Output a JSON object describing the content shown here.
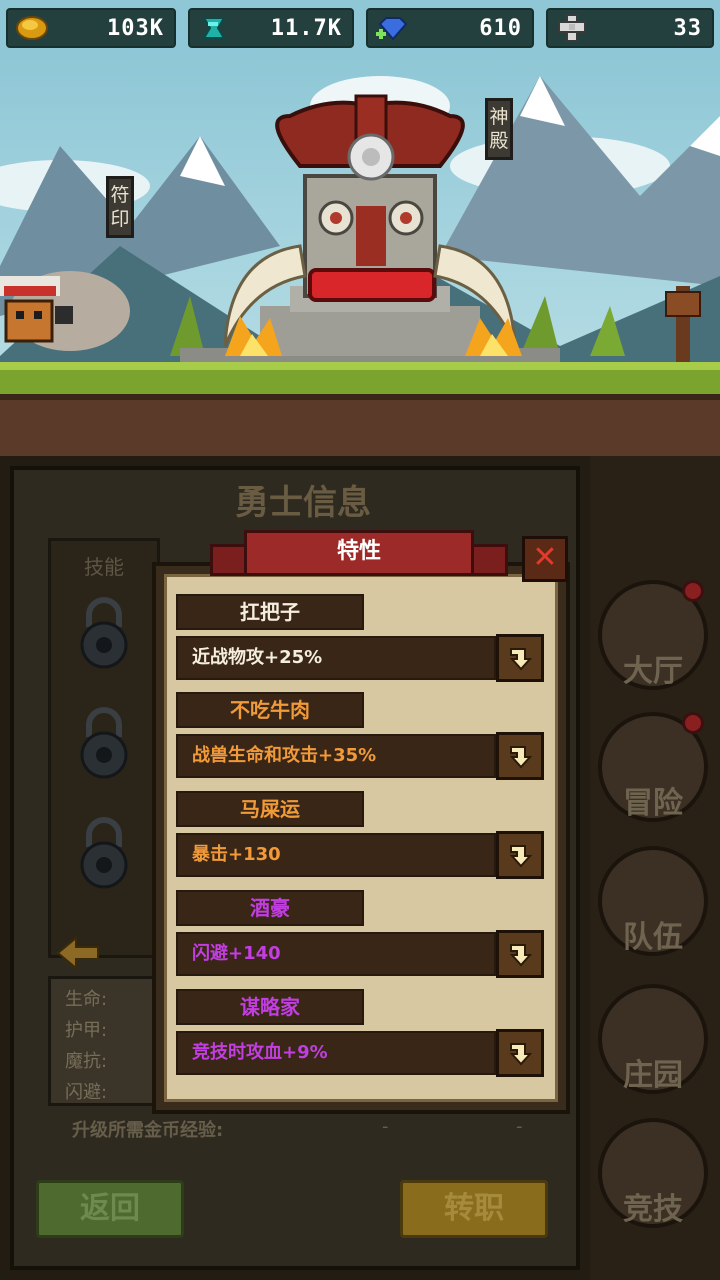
{
  "resources": {
    "gold": {
      "icon": "gold-coin-icon",
      "value": "103K"
    },
    "crystal": {
      "icon": "crystal-icon",
      "value": "11.7K"
    },
    "gem": {
      "icon": "gem-plus-icon",
      "value": "610"
    },
    "cross": {
      "icon": "cross-icon",
      "value": "33"
    }
  },
  "scene": {
    "sign_left": "符印",
    "sign_right": "神殿"
  },
  "hero_panel": {
    "title": "勇士信息",
    "skills_label": "技能",
    "stats": [
      "生命:",
      "护甲:",
      "魔抗:",
      "闪避:"
    ],
    "upgrade_label": "升级所需金币经验:",
    "upgrade_values": [
      "-",
      "-"
    ]
  },
  "buttons": {
    "back": "返回",
    "change_job": "转职"
  },
  "side_nav": [
    {
      "label": "大厅",
      "icon": "hall-icon",
      "alert": true
    },
    {
      "label": "冒险",
      "icon": "adventure-icon",
      "alert": true
    },
    {
      "label": "队伍",
      "icon": "team-icon",
      "alert": false
    },
    {
      "label": "庄园",
      "icon": "manor-icon",
      "alert": false
    },
    {
      "label": "竞技",
      "icon": "arena-icon",
      "alert": false
    }
  ],
  "dialog": {
    "title": "特性",
    "close_icon": "close-icon",
    "traits": [
      {
        "name": "扛把子",
        "name_color": "white",
        "effect": "近战物攻+25%",
        "effect_color": "white"
      },
      {
        "name": "不吃牛肉",
        "name_color": "orange",
        "effect": "战兽生命和攻击+35%",
        "effect_color": "orange"
      },
      {
        "name": "马屎运",
        "name_color": "orange",
        "effect": "暴击+130",
        "effect_color": "orange"
      },
      {
        "name": "酒豪",
        "name_color": "purple",
        "effect": "闪避+140",
        "effect_color": "purple"
      },
      {
        "name": "谋略家",
        "name_color": "purple",
        "effect": "竞技时攻血+9%",
        "effect_color": "purple"
      }
    ]
  },
  "colors": {
    "white": "#f4eedf",
    "orange": "#f09a3a",
    "purple": "#c13ee0",
    "ribbon": "#9c2a28"
  }
}
